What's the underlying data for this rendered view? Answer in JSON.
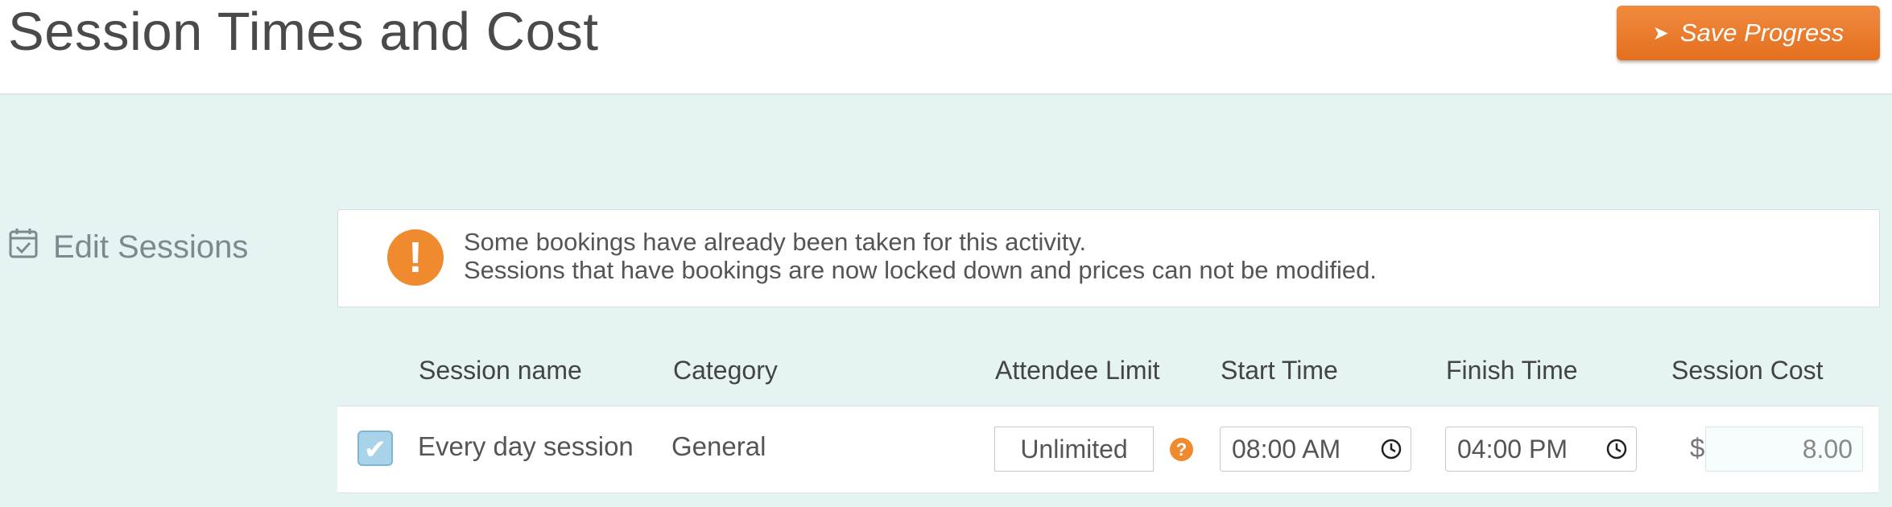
{
  "header": {
    "title": "Session Times and Cost",
    "save_label": "Save Progress",
    "save_icon": "arrow-right-icon",
    "accent_color": "#e8782a"
  },
  "section": {
    "label": "Edit Sessions",
    "icon": "calendar-check-icon"
  },
  "notice": {
    "icon": "exclamation-icon",
    "line1": "Some bookings have already been taken for this activity.",
    "line2": "Sessions that have bookings are now locked down and prices can not be modified."
  },
  "table": {
    "columns": [
      "Session name",
      "Category",
      "Attendee Limit",
      "Start Time",
      "Finish Time",
      "Session Cost"
    ],
    "rows": [
      {
        "checked": true,
        "session_name": "Every day session",
        "category": "General",
        "attendee_limit": "Unlimited",
        "start_time": "08:00 AM",
        "finish_time": "04:00 PM",
        "currency": "$",
        "cost": "8.00"
      }
    ]
  },
  "background_color": "#e5f3f3"
}
